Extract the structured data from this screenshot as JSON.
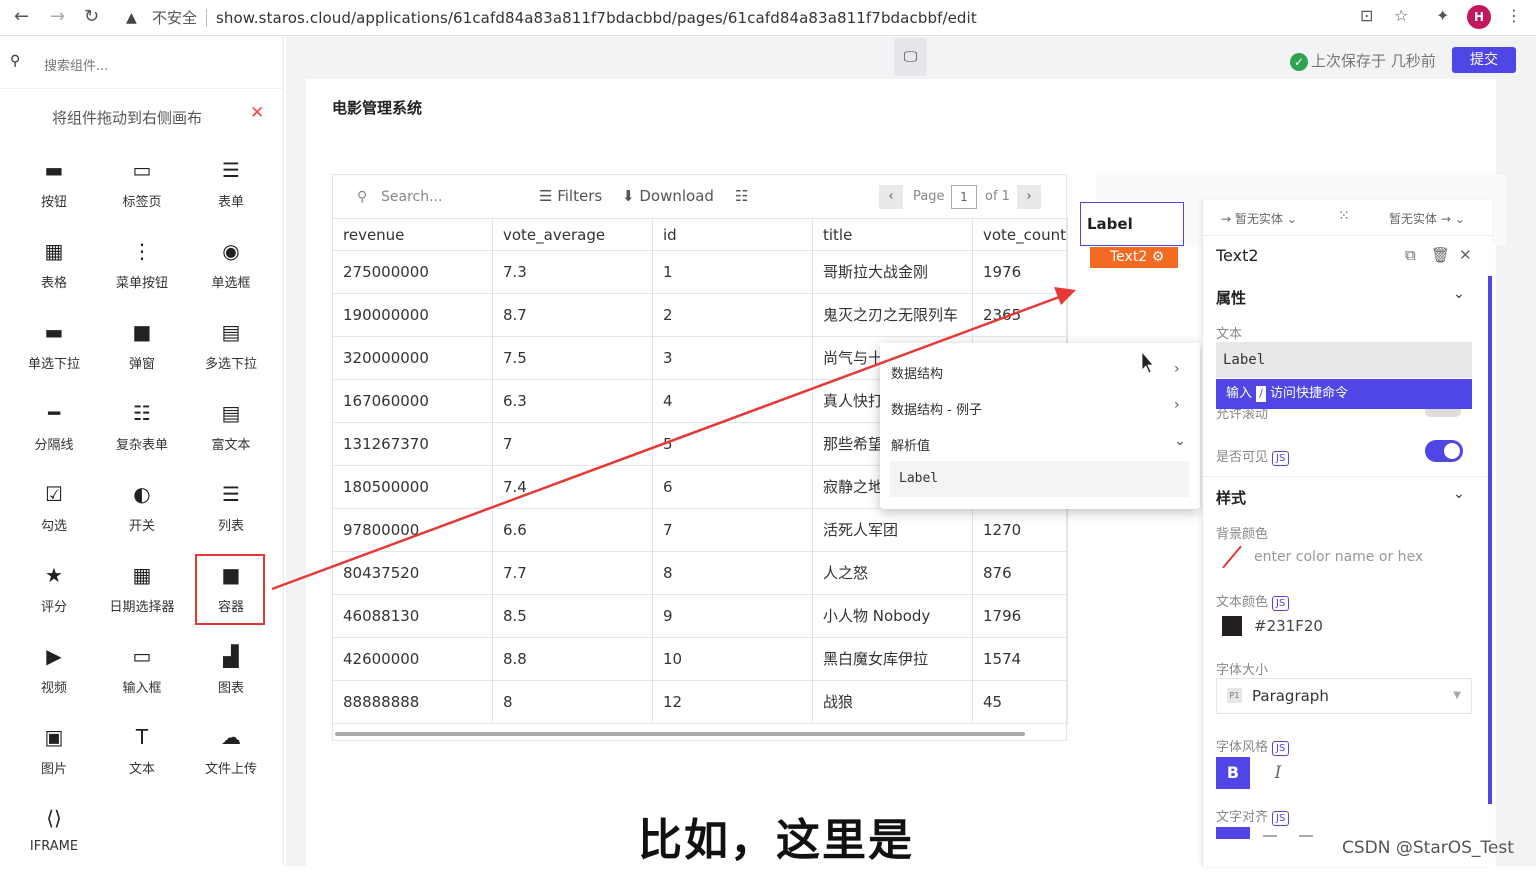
{
  "browser": {
    "insecure_label": "不安全",
    "url": "show.staros.cloud/applications/61cafd84a83a811f7bdacbbd/pages/61cafd84a83a811f7bdacbbf/edit",
    "avatar_letter": "H"
  },
  "sidebar": {
    "search_placeholder": "搜索组件...",
    "hint": "将组件拖动到右侧画布",
    "components": [
      {
        "label": "按钮",
        "icon": "submit-button-icon"
      },
      {
        "label": "标签页",
        "icon": "tabs-icon"
      },
      {
        "label": "表单",
        "icon": "form-icon"
      },
      {
        "label": "表格",
        "icon": "table-icon"
      },
      {
        "label": "菜单按钮",
        "icon": "menu-dots-icon"
      },
      {
        "label": "单选框",
        "icon": "radio-icon"
      },
      {
        "label": "单选下拉",
        "icon": "dropdown-icon"
      },
      {
        "label": "弹窗",
        "icon": "modal-icon"
      },
      {
        "label": "多选下拉",
        "icon": "multiselect-icon"
      },
      {
        "label": "分隔线",
        "icon": "divider-icon"
      },
      {
        "label": "复杂表单",
        "icon": "complex-form-icon"
      },
      {
        "label": "富文本",
        "icon": "richtext-icon"
      },
      {
        "label": "勾选",
        "icon": "checkbox-icon"
      },
      {
        "label": "开关",
        "icon": "switch-icon"
      },
      {
        "label": "列表",
        "icon": "list-icon"
      },
      {
        "label": "评分",
        "icon": "star-icon"
      },
      {
        "label": "日期选择器",
        "icon": "calendar-icon"
      },
      {
        "label": "容器",
        "icon": "container-icon"
      },
      {
        "label": "视频",
        "icon": "video-icon"
      },
      {
        "label": "输入框",
        "icon": "input-icon"
      },
      {
        "label": "图表",
        "icon": "chart-icon"
      },
      {
        "label": "图片",
        "icon": "image-icon"
      },
      {
        "label": "文本",
        "icon": "text-icon"
      },
      {
        "label": "文件上传",
        "icon": "upload-icon"
      },
      {
        "label": "IFRAME",
        "icon": "iframe-icon"
      }
    ]
  },
  "header": {
    "saved_text": "上次保存于 几秒前",
    "submit_label": "提交"
  },
  "page": {
    "title": "电影管理系统"
  },
  "table": {
    "search_placeholder": "Search...",
    "filters_label": "Filters",
    "download_label": "Download",
    "page_label": "Page",
    "page_value": "1",
    "page_of": "of 1",
    "columns": [
      "revenue",
      "vote_average",
      "id",
      "title",
      "vote_count"
    ],
    "rows": [
      [
        "275000000",
        "7.3",
        "1",
        "哥斯拉大战金刚",
        "1976"
      ],
      [
        "190000000",
        "8.7",
        "2",
        "鬼灭之刃之无限列车",
        "2365"
      ],
      [
        "320000000",
        "7.5",
        "3",
        "尚气与十",
        ""
      ],
      [
        "167060000",
        "6.3",
        "4",
        "真人快打",
        ""
      ],
      [
        "131267370",
        "7",
        "5",
        "那些希望",
        ""
      ],
      [
        "180500000",
        "7.4",
        "6",
        "寂静之地",
        ""
      ],
      [
        "97800000",
        "6.6",
        "7",
        "活死人军团",
        "1270"
      ],
      [
        "80437520",
        "7.7",
        "8",
        "人之怒",
        "876"
      ],
      [
        "46088130",
        "8.5",
        "9",
        "小人物 Nobody",
        "1796"
      ],
      [
        "42600000",
        "8.8",
        "10",
        "黑白魔女库伊拉",
        "1574"
      ],
      [
        "88888888",
        "8",
        "12",
        "战狼",
        "45"
      ]
    ]
  },
  "widget": {
    "label_text": "Label",
    "tag": "Text2"
  },
  "context_menu": {
    "items": [
      "数据结构",
      "数据结构 - 例子",
      "解析值"
    ],
    "value": "Label"
  },
  "inspector": {
    "entity_left": "暂无实体",
    "entity_right": "暂无实体",
    "title": "Text2",
    "props_header": "属性",
    "text_label": "文本",
    "text_value": "Label",
    "command_prefix": "输入",
    "command_key": "/",
    "command_suffix": "访问快捷命令",
    "hidden_row": "允许滚动",
    "visible_label": "是否可见",
    "js": "JS",
    "style_header": "样式",
    "bg_label": "背景颜色",
    "bg_placeholder": "enter color name or hex",
    "text_color_label": "文本颜色",
    "text_color_value": "#231F20",
    "font_size_label": "字体大小",
    "font_size_tag": "P1",
    "font_size_value": "Paragraph",
    "font_style_label": "字体风格",
    "bold": "B",
    "italic": "I",
    "align_label": "文字对齐"
  },
  "overlay": {
    "caption": "比如，这里是",
    "watermark": "CSDN @StarOS_Test"
  },
  "colors": {
    "accent": "#4f46e5",
    "tag_orange": "#f26b21",
    "annotation_red": "#e53935"
  }
}
